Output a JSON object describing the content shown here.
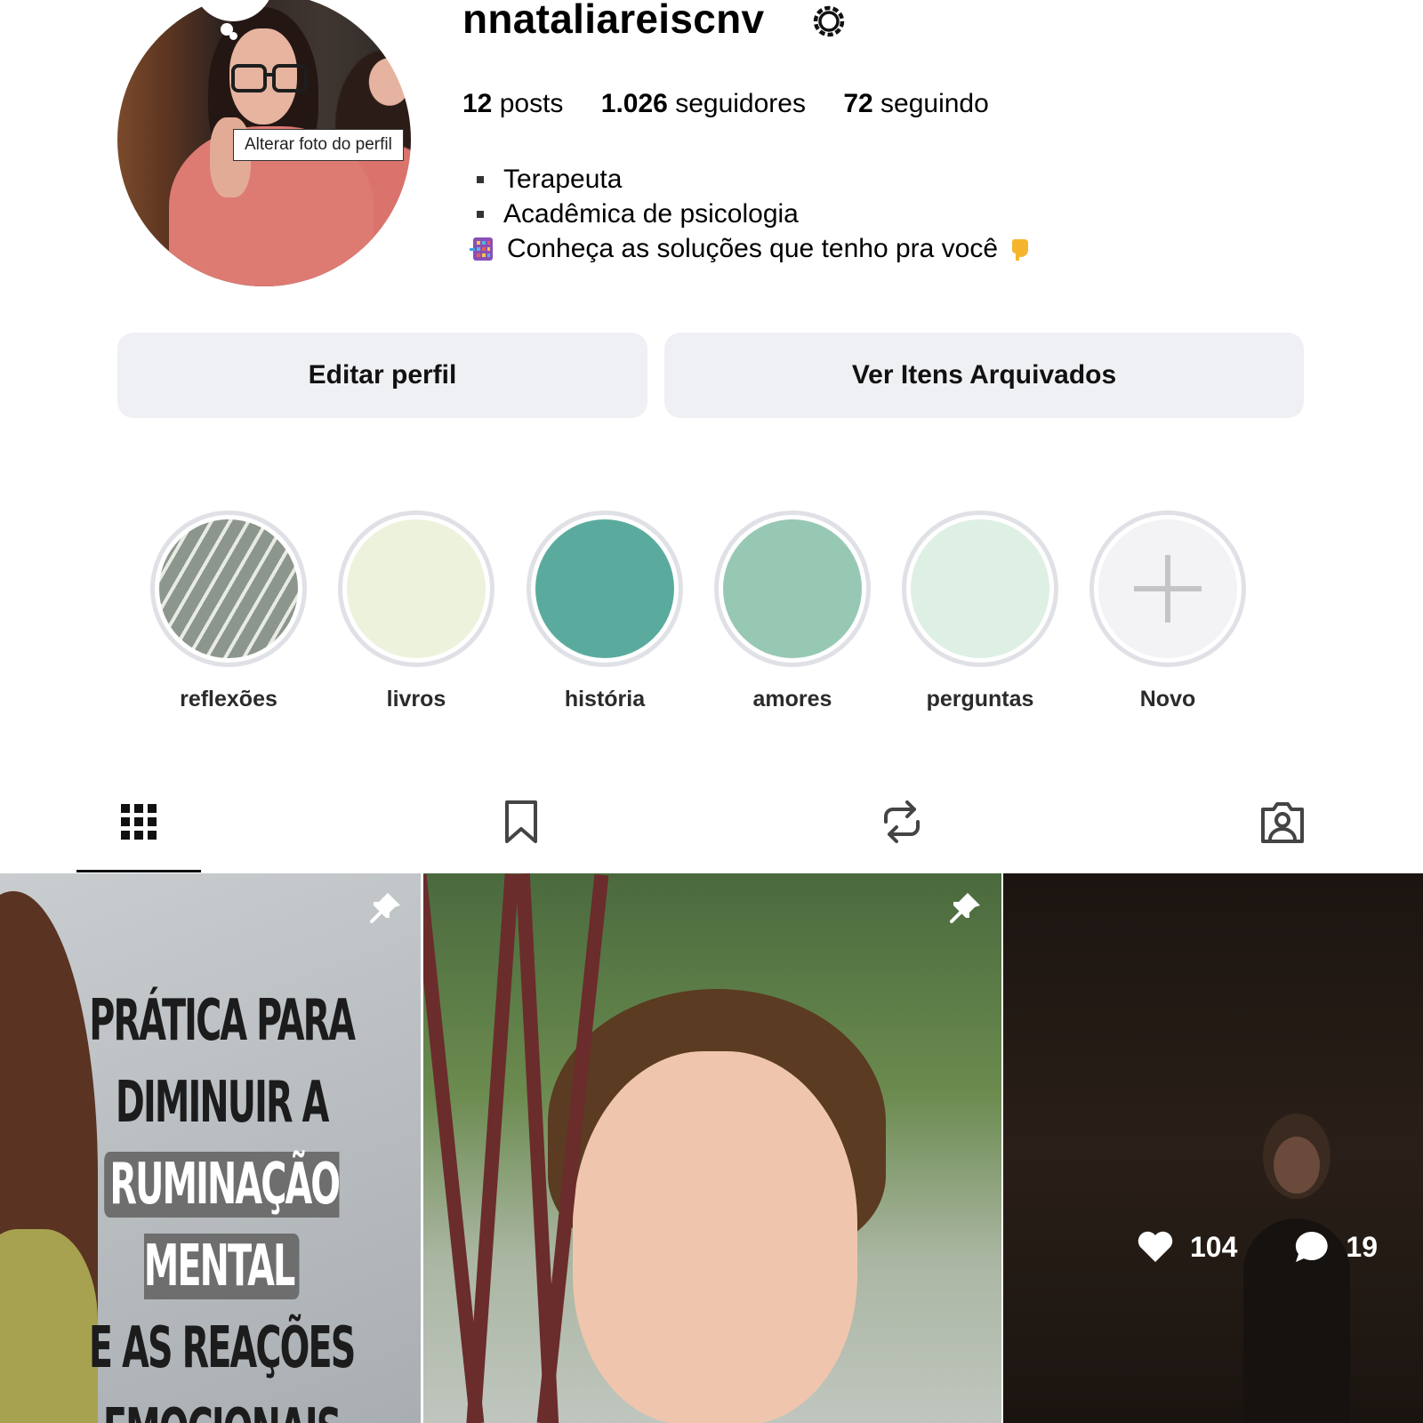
{
  "profile": {
    "username": "nnataliareiscnv",
    "avatar_tooltip": "Alterar foto do perfil",
    "stats": [
      {
        "value": "12",
        "label": "posts"
      },
      {
        "value": "1.026",
        "label": "seguidores"
      },
      {
        "value": "72",
        "label": "seguindo"
      }
    ],
    "bio": [
      "Terapeuta",
      "Acadêmica de psicologia",
      "Conheça as soluções que tenho pra você"
    ]
  },
  "buttons": {
    "edit": "Editar perfil",
    "archive": "Ver Itens Arquivados"
  },
  "highlights": [
    {
      "label": "reflexões",
      "color": "#9aa39a"
    },
    {
      "label": "livros",
      "color": "#edf2dc"
    },
    {
      "label": "história",
      "color": "#5aab9e"
    },
    {
      "label": "amores",
      "color": "#97c8b4"
    },
    {
      "label": "perguntas",
      "color": "#deefe4"
    },
    {
      "label": "Novo",
      "color": "#f3f3f5"
    }
  ],
  "tabs": [
    {
      "icon": "grid-icon",
      "active": true
    },
    {
      "icon": "bookmark-icon",
      "active": false
    },
    {
      "icon": "repost-icon",
      "active": false
    },
    {
      "icon": "tagged-icon",
      "active": false
    }
  ],
  "posts": {
    "post1": {
      "pinned": true,
      "lines": [
        "PRÁTICA PARA",
        "DIMINUIR A",
        "RUMINAÇÃO MENTAL",
        "E AS REAÇÕES",
        "EMOCIONAIS"
      ]
    },
    "post2": {
      "pinned": true
    },
    "post3": {
      "likes": "104",
      "comments": "19"
    }
  }
}
